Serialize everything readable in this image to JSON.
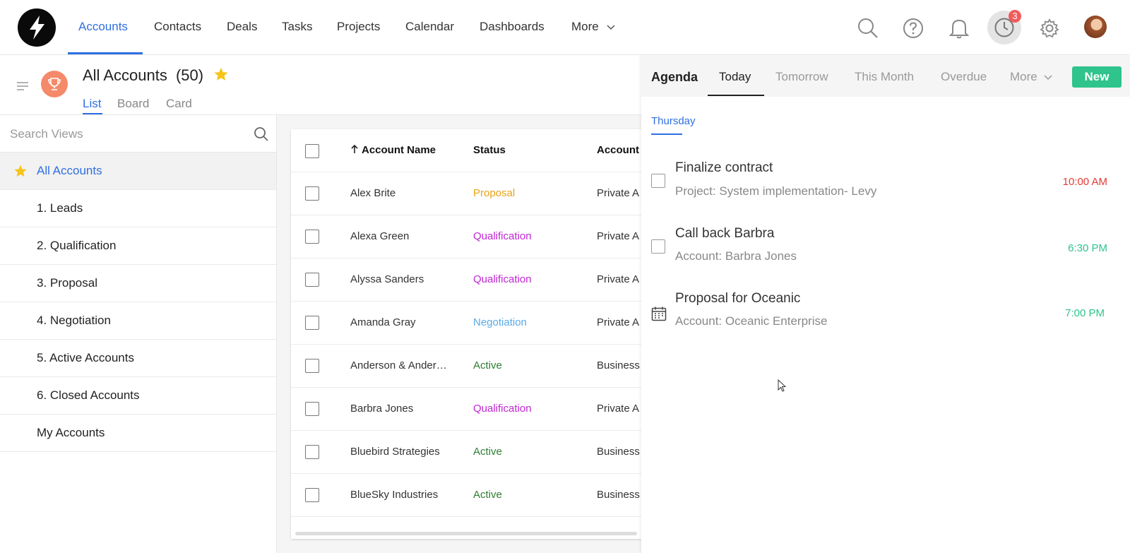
{
  "nav": {
    "items": [
      {
        "label": "Accounts",
        "active": true
      },
      {
        "label": "Contacts"
      },
      {
        "label": "Deals"
      },
      {
        "label": "Tasks"
      },
      {
        "label": "Projects"
      },
      {
        "label": "Calendar"
      },
      {
        "label": "Dashboards"
      },
      {
        "label": "More"
      }
    ],
    "reminder_count": "3",
    "accent": "#2f6fe0"
  },
  "header": {
    "title": "All Accounts",
    "count": "(50)",
    "view_tabs": [
      "List",
      "Board",
      "Card"
    ]
  },
  "sidebar": {
    "search_placeholder": "Search Views",
    "items": [
      {
        "label": "All Accounts",
        "selected": true,
        "starred": true
      },
      {
        "label": "1. Leads"
      },
      {
        "label": "2. Qualification"
      },
      {
        "label": "3. Proposal"
      },
      {
        "label": "4. Negotiation"
      },
      {
        "label": "5. Active Accounts"
      },
      {
        "label": "6. Closed Accounts"
      },
      {
        "label": "My Accounts"
      }
    ]
  },
  "table": {
    "columns": [
      "Account Name",
      "Status",
      "Account"
    ],
    "rows": [
      {
        "name": "Alex Brite",
        "status": "Proposal",
        "status_color": "#e8a317",
        "type": "Private A"
      },
      {
        "name": "Alexa Green",
        "status": "Qualification",
        "status_color": "#c026d3",
        "type": "Private A"
      },
      {
        "name": "Alyssa Sanders",
        "status": "Qualification",
        "status_color": "#c026d3",
        "type": "Private A"
      },
      {
        "name": "Amanda Gray",
        "status": "Negotiation",
        "status_color": "#5aa9e6",
        "type": "Private A"
      },
      {
        "name": "Anderson & Ander…",
        "status": "Active",
        "status_color": "#2e7d32",
        "type": "Business"
      },
      {
        "name": "Barbra Jones",
        "status": "Qualification",
        "status_color": "#c026d3",
        "type": "Private A"
      },
      {
        "name": "Bluebird Strategies",
        "status": "Active",
        "status_color": "#2e7d32",
        "type": "Business"
      },
      {
        "name": "BlueSky Industries",
        "status": "Active",
        "status_color": "#2e7d32",
        "type": "Business"
      }
    ]
  },
  "agenda": {
    "title": "Agenda",
    "tabs": [
      "Today",
      "Tomorrow",
      "This Month",
      "Overdue",
      "More"
    ],
    "active_tab": "Today",
    "new_label": "New",
    "day": "Thursday",
    "tasks": [
      {
        "title": "Finalize contract",
        "subtitle": "Project: System implementation- Levy",
        "time": "10:00 AM",
        "time_color": "#e53935",
        "kind": "task"
      },
      {
        "title": "Call back Barbra",
        "subtitle": "Account: Barbra Jones",
        "time": "6:30 PM",
        "time_color": "#2ec48c",
        "kind": "task"
      },
      {
        "title": "Proposal for Oceanic",
        "subtitle": "Account: Oceanic Enterprise",
        "time": "7:00 PM",
        "time_color": "#2ec48c",
        "kind": "event"
      }
    ]
  }
}
